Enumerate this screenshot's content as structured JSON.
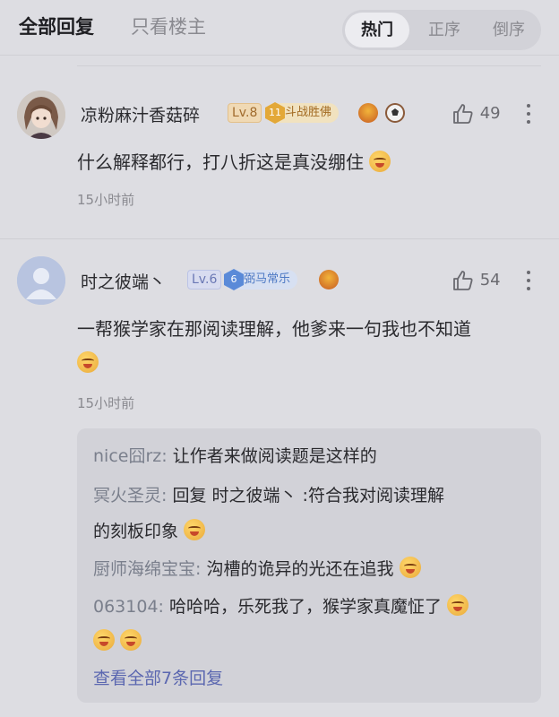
{
  "header": {
    "tab_all": "全部回复",
    "tab_op_only": "只看楼主",
    "sort": [
      "热门",
      "正序",
      "倒序"
    ]
  },
  "comments": [
    {
      "username": "凉粉麻汁香菇碎",
      "level": "Lv.8",
      "badge_num": "11",
      "badge_text": "斗战胜佛",
      "likes": "49",
      "content": "什么解释都行，打八折这是真没绷住",
      "time": "15小时前"
    },
    {
      "username": "时之彼端丶",
      "level": "Lv.6",
      "badge_num": "6",
      "badge_text": "弼马常乐",
      "likes": "54",
      "content_line1": "一帮猴学家在那阅读理解，他爹来一句我也不知道",
      "time": "15小时前",
      "replies": [
        {
          "name": "nice囧rz",
          "sep": ": ",
          "text": "让作者来做阅读题是这样的"
        },
        {
          "name": "冥火圣灵",
          "sep": ": ",
          "text": "回复 时之彼端丶 :符合我对阅读理解",
          "text2": "的刻板印象"
        },
        {
          "name": "厨师海绵宝宝",
          "sep": ": ",
          "text": "沟槽的诡异的光还在追我"
        },
        {
          "name": "063104",
          "sep": ": ",
          "text": "哈哈哈，乐死我了，猴学家真魔怔了"
        }
      ],
      "view_all": "查看全部7条回复"
    }
  ],
  "colors": {
    "background": "#dddde2",
    "reply_box": "#d2d2d8",
    "link": "#5b67b0",
    "lv8": "#a06a2c",
    "lv6": "#6a78b4"
  },
  "icons": [
    "like-icon",
    "more-icon",
    "emoji-laugh-icon"
  ]
}
